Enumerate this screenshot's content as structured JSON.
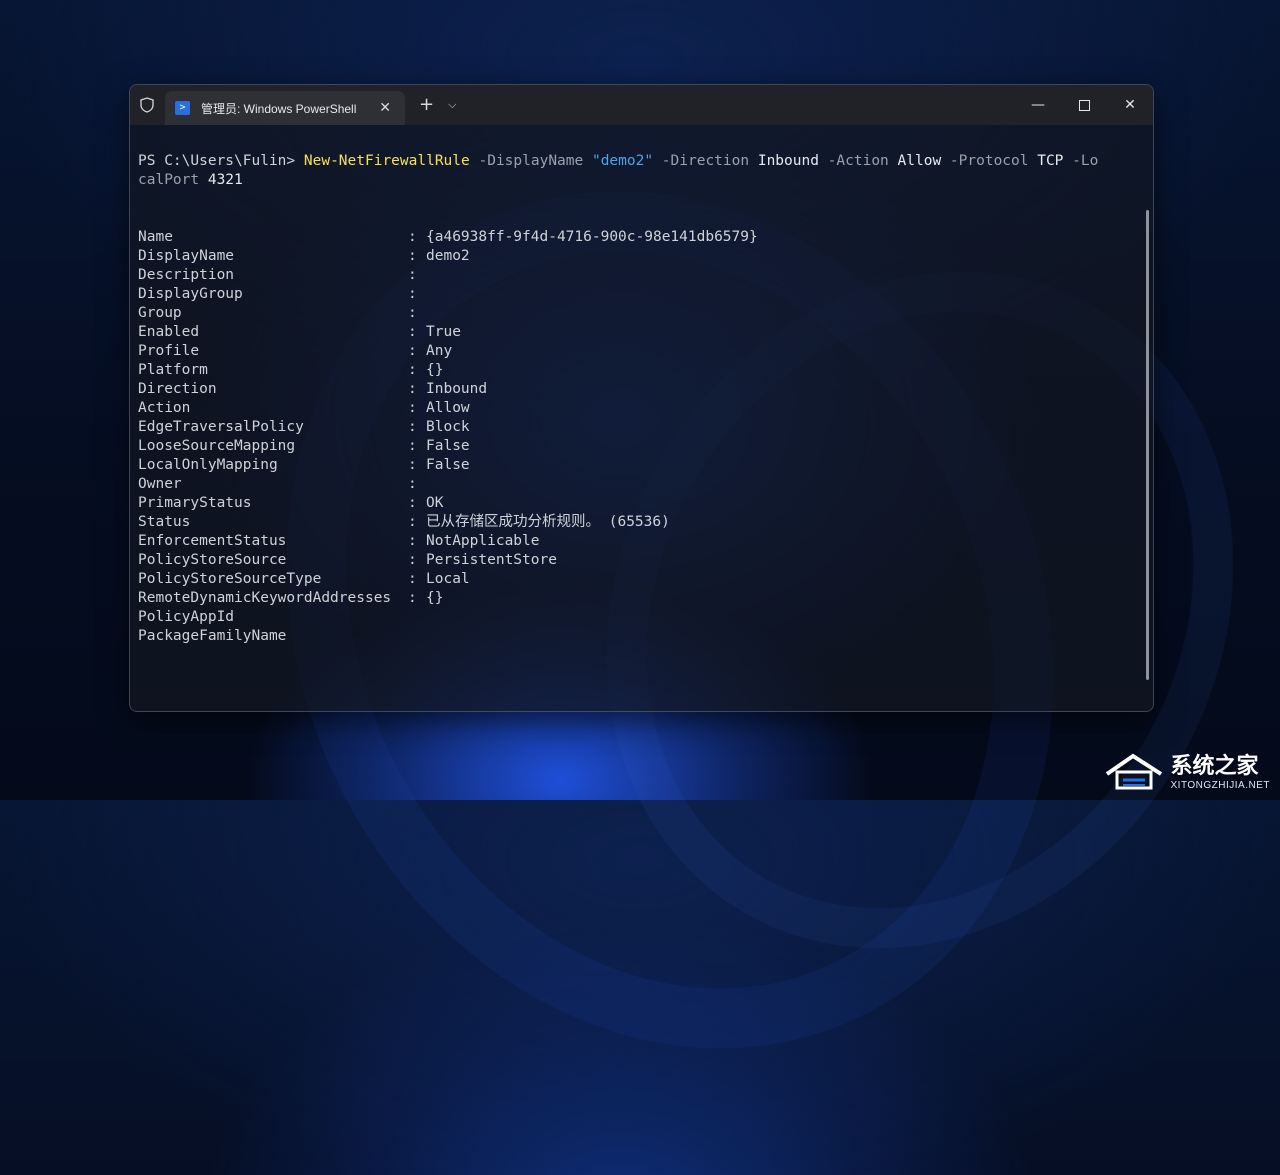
{
  "window": {
    "tab_title": "管理员: Windows PowerShell",
    "icons": {
      "shield": "shield-icon",
      "powershell": "powershell-icon",
      "tab_close": "close-icon",
      "new_tab": "plus-icon",
      "dropdown": "chevron-down-icon",
      "minimize": "minimize-icon",
      "maximize": "maximize-icon",
      "close": "close-icon"
    }
  },
  "terminal": {
    "prompt": "PS C:\\Users\\Fulin> ",
    "command": {
      "cmdlet": "New-NetFirewallRule",
      "p1": " -DisplayName ",
      "v1": "\"demo2\"",
      "p2": " -Direction ",
      "v2": "Inbound",
      "p3": " -Action ",
      "v3": "Allow",
      "p4": " -Protocol ",
      "v4": "TCP",
      "p5": " -Lo",
      "p5b": "calPort",
      "v5": " 4321"
    },
    "output": [
      {
        "key": "Name",
        "sep": ":",
        "value": "{a46938ff-9f4d-4716-900c-98e141db6579}"
      },
      {
        "key": "DisplayName",
        "sep": ":",
        "value": "demo2"
      },
      {
        "key": "Description",
        "sep": ":",
        "value": ""
      },
      {
        "key": "DisplayGroup",
        "sep": ":",
        "value": ""
      },
      {
        "key": "Group",
        "sep": ":",
        "value": ""
      },
      {
        "key": "Enabled",
        "sep": ":",
        "value": "True"
      },
      {
        "key": "Profile",
        "sep": ":",
        "value": "Any"
      },
      {
        "key": "Platform",
        "sep": ":",
        "value": "{}"
      },
      {
        "key": "Direction",
        "sep": ":",
        "value": "Inbound"
      },
      {
        "key": "Action",
        "sep": ":",
        "value": "Allow"
      },
      {
        "key": "EdgeTraversalPolicy",
        "sep": ":",
        "value": "Block"
      },
      {
        "key": "LooseSourceMapping",
        "sep": ":",
        "value": "False"
      },
      {
        "key": "LocalOnlyMapping",
        "sep": ":",
        "value": "False"
      },
      {
        "key": "Owner",
        "sep": ":",
        "value": ""
      },
      {
        "key": "PrimaryStatus",
        "sep": ":",
        "value": "OK"
      },
      {
        "key": "Status",
        "sep": ":",
        "value": "已从存储区成功分析规则。 (65536)"
      },
      {
        "key": "EnforcementStatus",
        "sep": ":",
        "value": "NotApplicable"
      },
      {
        "key": "PolicyStoreSource",
        "sep": ":",
        "value": "PersistentStore"
      },
      {
        "key": "PolicyStoreSourceType",
        "sep": ":",
        "value": "Local"
      },
      {
        "key": "RemoteDynamicKeywordAddresses",
        "sep": ":",
        "value": "{}"
      },
      {
        "key": "PolicyAppId",
        "sep": "",
        "value": ""
      },
      {
        "key": "PackageFamilyName",
        "sep": "",
        "value": ""
      }
    ]
  },
  "watermark": {
    "title": "系统之家",
    "subtitle": "XITONGZHIJIA.NET"
  },
  "colors": {
    "cmdlet": "#f5e05a",
    "parameter": "#9ba0aa",
    "string": "#4fa3e8",
    "text": "#cfd2d8"
  }
}
